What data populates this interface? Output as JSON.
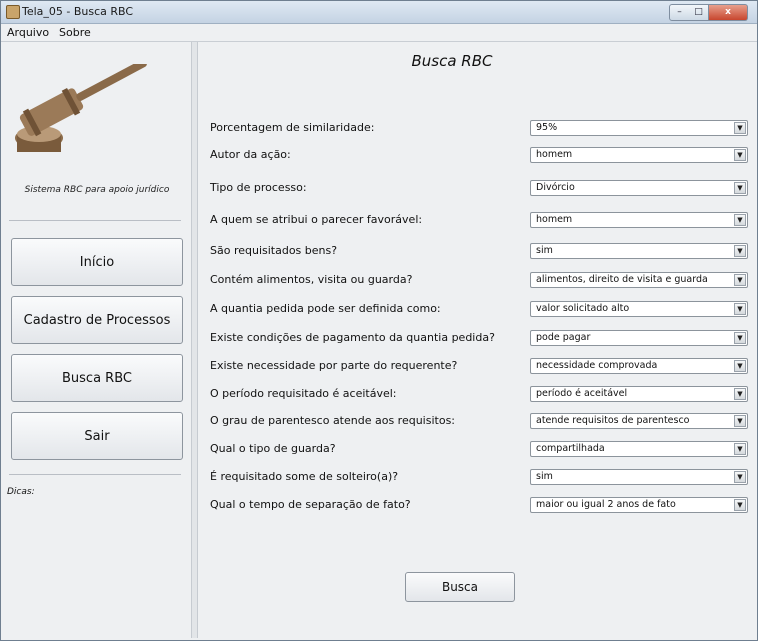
{
  "window": {
    "title": "Tela_05 - Busca RBC",
    "controls": {
      "minimize": "–",
      "maximize": "□",
      "close": "x"
    }
  },
  "menu": [
    "Arquivo",
    "Sobre"
  ],
  "sidebar": {
    "caption": "Sistema RBC para apoio jurídico",
    "buttons": [
      "Início",
      "Cadastro de Processos",
      "Busca RBC",
      "Sair"
    ],
    "tips_label": "Dicas:"
  },
  "main": {
    "heading": "Busca RBC",
    "fields": [
      {
        "label": "Porcentagem de similaridade:",
        "value": "95%"
      },
      {
        "label": "Autor da ação:",
        "value": "homem"
      },
      {
        "label": "Tipo de processo:",
        "value": "Divórcio"
      },
      {
        "label": "A quem se atribui o parecer favorável:",
        "value": "homem"
      },
      {
        "label": "São requisitados bens?",
        "value": "sim"
      },
      {
        "label": "Contém alimentos, visita ou guarda?",
        "value": "alimentos, direito de visita e guarda"
      },
      {
        "label": "A quantia pedida pode ser definida como:",
        "value": "valor solicitado alto"
      },
      {
        "label": "Existe condições de pagamento da quantia pedida?",
        "value": "pode pagar"
      },
      {
        "label": "Existe necessidade por parte do requerente?",
        "value": "necessidade comprovada"
      },
      {
        "label": "O período requisitado é aceitável:",
        "value": "período é aceitável"
      },
      {
        "label": "O grau de parentesco atende aos requisitos:",
        "value": "atende requisitos de parentesco"
      },
      {
        "label": "Qual o tipo de guarda?",
        "value": "compartilhada"
      },
      {
        "label": "É requisitado some de solteiro(a)?",
        "value": "sim"
      },
      {
        "label": "Qual o tempo de separação de fato?",
        "value": "maior ou igual 2 anos de fato"
      }
    ],
    "search_button": "Busca"
  }
}
